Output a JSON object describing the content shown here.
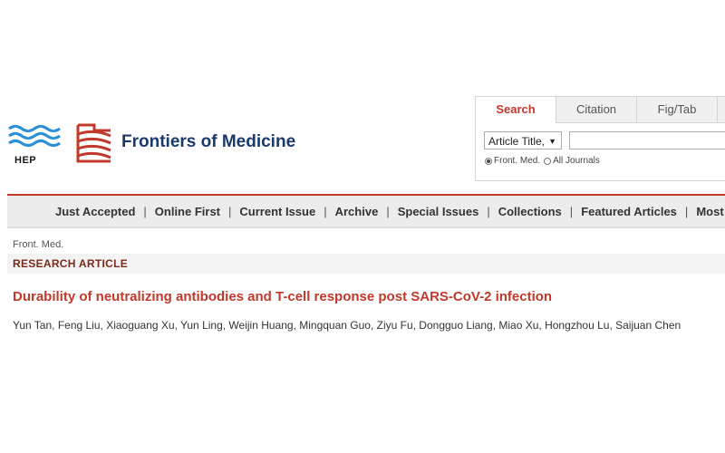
{
  "header": {
    "hep_label": "HEP",
    "site_title": "Frontiers of Medicine"
  },
  "search_panel": {
    "tabs": [
      {
        "label": "Search"
      },
      {
        "label": "Citation"
      },
      {
        "label": "Fig/Tab"
      }
    ],
    "active_tab": "Search",
    "field_select": "Article Title,",
    "query_value": "",
    "scope_options": [
      {
        "label": "Front. Med.",
        "selected": true
      },
      {
        "label": "All Journals",
        "selected": false
      }
    ]
  },
  "nav": {
    "items": [
      {
        "label": "Just Accepted"
      },
      {
        "label": "Online First"
      },
      {
        "label": "Current Issue"
      },
      {
        "label": "Archive"
      },
      {
        "label": "Special Issues"
      },
      {
        "label": "Collections"
      },
      {
        "label": "Featured Articles"
      },
      {
        "label": "Most Downlo"
      }
    ],
    "separator": "|"
  },
  "article": {
    "journal": "Front. Med.",
    "type": "RESEARCH ARTICLE",
    "title": "Durability of neutralizing antibodies and T-cell response post SARS-CoV-2 infection",
    "authors": "Yun Tan, Feng Liu, Xiaoguang Xu, Yun Ling, Weijin Huang, Mingquan Guo, Ziyu Fu, Dongguo Liang, Miao Xu, Hongzhou Lu, Saijuan Chen"
  },
  "colors": {
    "accent_red": "#c0392b",
    "title_blue": "#1a3a6e",
    "logo_blue": "#2b8fd6"
  }
}
